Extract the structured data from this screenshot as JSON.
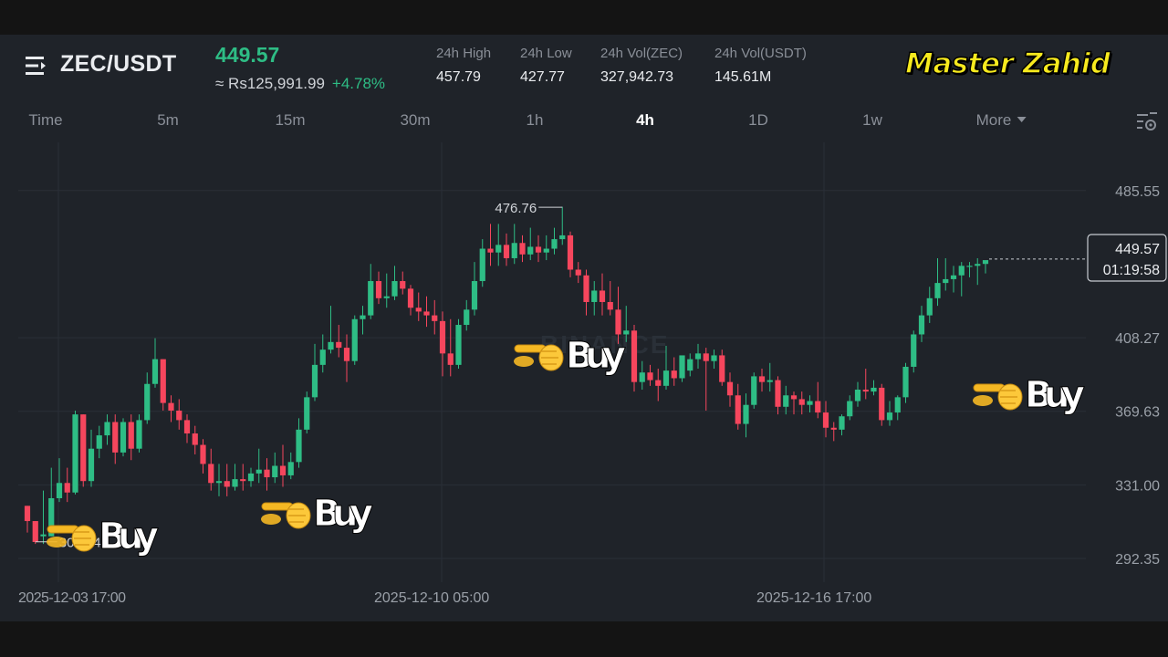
{
  "header": {
    "pair": "ZEC/USDT",
    "price": "449.57",
    "fiat_price": "≈ Rs125,991.99",
    "change": "+4.78%",
    "stats": [
      {
        "label": "24h High",
        "value": "457.79"
      },
      {
        "label": "24h Low",
        "value": "427.77"
      },
      {
        "label": "24h Vol(ZEC)",
        "value": "327,942.73"
      },
      {
        "label": "24h Vol(USDT)",
        "value": "145.61M"
      }
    ],
    "brand": "Master Zahid"
  },
  "tabs": [
    {
      "label": "Time"
    },
    {
      "label": "5m"
    },
    {
      "label": "15m"
    },
    {
      "label": "30m"
    },
    {
      "label": "1h"
    },
    {
      "label": "4h",
      "active": true
    },
    {
      "label": "1D"
    },
    {
      "label": "1w"
    },
    {
      "label": "More"
    }
  ],
  "icons": {
    "menu": "menu-lines-icon",
    "settings": "chart-settings-icon",
    "pointer": "pointing-hand-icon"
  },
  "colors": {
    "up": "#2ebd85",
    "down": "#f6465d",
    "brand": "#f7ea1e",
    "background": "#1f2329"
  },
  "watermark": "BINANCE",
  "chart_data": {
    "type": "candlestick",
    "ylim": [
      285,
      500
    ],
    "y_ticks": [
      "485.55",
      "408.27",
      "369.63",
      "331.00",
      "292.35"
    ],
    "x_ticks": [
      "2025-12-03 17:00",
      "2025-12-10 05:00",
      "2025-12-16 17:00"
    ],
    "high_label": "476.76",
    "low_label": "301.14",
    "last_price": "449.57",
    "countdown": "01:19:58",
    "buy_label": "Buy",
    "buy_marks": 4,
    "candles": [
      [
        320,
        320,
        312,
        306
      ],
      [
        312,
        312,
        301,
        300
      ],
      [
        304,
        328,
        305,
        300
      ],
      [
        304,
        340,
        324,
        304
      ],
      [
        324,
        345,
        332,
        322
      ],
      [
        332,
        340,
        327,
        322
      ],
      [
        327,
        370,
        368,
        326
      ],
      [
        368,
        368,
        333,
        330
      ],
      [
        333,
        360,
        350,
        330
      ],
      [
        350,
        362,
        357,
        345
      ],
      [
        357,
        368,
        364,
        352
      ],
      [
        364,
        368,
        348,
        342
      ],
      [
        348,
        366,
        364,
        346
      ],
      [
        364,
        368,
        350,
        344
      ],
      [
        350,
        368,
        365,
        348
      ],
      [
        365,
        390,
        384,
        363
      ],
      [
        384,
        408,
        397,
        382
      ],
      [
        397,
        397,
        374,
        370
      ],
      [
        374,
        378,
        370,
        364
      ],
      [
        370,
        376,
        365,
        360
      ],
      [
        365,
        368,
        358,
        353
      ],
      [
        358,
        362,
        352,
        347
      ],
      [
        352,
        355,
        342,
        337
      ],
      [
        342,
        350,
        332,
        328
      ],
      [
        332,
        342,
        333,
        325
      ],
      [
        333,
        342,
        330,
        325
      ],
      [
        330,
        342,
        334,
        328
      ],
      [
        334,
        342,
        333,
        328
      ],
      [
        333,
        340,
        337,
        330
      ],
      [
        337,
        350,
        339,
        332
      ],
      [
        339,
        345,
        335,
        328
      ],
      [
        335,
        348,
        341,
        332
      ],
      [
        341,
        352,
        336,
        330
      ],
      [
        336,
        348,
        343,
        334
      ],
      [
        343,
        366,
        360,
        340
      ],
      [
        360,
        380,
        377,
        358
      ],
      [
        377,
        405,
        394,
        375
      ],
      [
        394,
        410,
        402,
        390
      ],
      [
        402,
        425,
        406,
        400
      ],
      [
        406,
        415,
        403,
        398
      ],
      [
        403,
        410,
        396,
        385
      ],
      [
        396,
        420,
        418,
        394
      ],
      [
        418,
        425,
        420,
        410
      ],
      [
        420,
        447,
        438,
        418
      ],
      [
        438,
        443,
        429,
        426
      ],
      [
        429,
        442,
        430,
        424
      ],
      [
        430,
        446,
        438,
        428
      ],
      [
        438,
        443,
        434,
        431
      ],
      [
        434,
        436,
        424,
        420
      ],
      [
        424,
        432,
        422,
        417
      ],
      [
        422,
        430,
        420,
        414
      ],
      [
        420,
        428,
        417,
        410
      ],
      [
        417,
        422,
        400,
        388
      ],
      [
        400,
        418,
        394,
        388
      ],
      [
        394,
        418,
        415,
        392
      ],
      [
        415,
        428,
        423,
        412
      ],
      [
        423,
        448,
        438,
        420
      ],
      [
        438,
        460,
        455,
        435
      ],
      [
        455,
        468,
        453,
        446
      ],
      [
        453,
        468,
        457,
        446
      ],
      [
        457,
        463,
        450,
        446
      ],
      [
        450,
        468,
        458,
        447
      ],
      [
        458,
        462,
        452,
        448
      ],
      [
        452,
        466,
        456,
        449
      ],
      [
        456,
        462,
        453,
        448
      ],
      [
        453,
        462,
        455,
        449
      ],
      [
        455,
        466,
        460,
        452
      ],
      [
        460,
        477,
        462,
        457
      ],
      [
        462,
        464,
        444,
        440
      ],
      [
        444,
        448,
        441,
        437
      ],
      [
        441,
        444,
        427,
        420
      ],
      [
        427,
        438,
        433,
        420
      ],
      [
        433,
        442,
        427,
        420
      ],
      [
        427,
        438,
        423,
        420
      ],
      [
        423,
        435,
        410,
        405
      ],
      [
        410,
        425,
        412,
        406
      ],
      [
        412,
        415,
        385,
        380
      ],
      [
        385,
        396,
        390,
        381
      ],
      [
        390,
        394,
        386,
        383
      ],
      [
        386,
        392,
        383,
        375
      ],
      [
        383,
        404,
        391,
        381
      ],
      [
        391,
        398,
        387,
        383
      ],
      [
        387,
        398,
        399,
        385
      ],
      [
        391,
        400,
        397,
        388
      ],
      [
        397,
        405,
        400,
        392
      ],
      [
        400,
        403,
        396,
        370
      ],
      [
        396,
        402,
        399,
        392
      ],
      [
        399,
        402,
        385,
        383
      ],
      [
        385,
        390,
        378,
        372
      ],
      [
        378,
        384,
        363,
        360
      ],
      [
        363,
        379,
        373,
        356
      ],
      [
        373,
        390,
        388,
        371
      ],
      [
        388,
        392,
        385,
        380
      ],
      [
        385,
        395,
        386,
        380
      ],
      [
        386,
        388,
        372,
        368
      ],
      [
        372,
        383,
        378,
        368
      ],
      [
        378,
        380,
        376,
        368
      ],
      [
        376,
        380,
        373,
        368
      ],
      [
        373,
        378,
        375,
        369
      ],
      [
        375,
        385,
        369,
        366
      ],
      [
        369,
        375,
        361,
        356
      ],
      [
        361,
        364,
        360,
        354
      ],
      [
        360,
        368,
        367,
        357
      ],
      [
        367,
        378,
        375,
        365
      ],
      [
        375,
        385,
        381,
        372
      ],
      [
        381,
        392,
        380,
        376
      ],
      [
        380,
        386,
        382,
        378
      ],
      [
        382,
        384,
        365,
        362
      ],
      [
        365,
        375,
        369,
        362
      ],
      [
        369,
        378,
        377,
        365
      ],
      [
        377,
        395,
        393,
        374
      ],
      [
        393,
        412,
        410,
        390
      ],
      [
        410,
        425,
        420,
        406
      ],
      [
        420,
        435,
        429,
        416
      ],
      [
        429,
        450,
        437,
        425
      ],
      [
        437,
        450,
        439,
        433
      ],
      [
        439,
        446,
        441,
        432
      ],
      [
        441,
        448,
        446,
        430
      ],
      [
        446,
        448,
        446,
        440
      ],
      [
        446,
        450,
        447,
        436
      ],
      [
        447,
        448,
        449,
        442
      ]
    ]
  }
}
